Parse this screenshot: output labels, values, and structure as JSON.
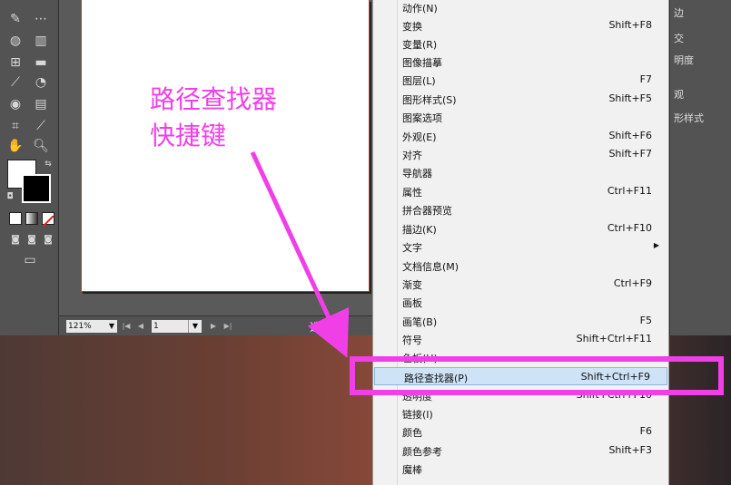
{
  "annotation": {
    "line1": "路径查找器",
    "line2": "快捷键"
  },
  "statusbar": {
    "zoom": "121%",
    "page": "1",
    "status": "选择"
  },
  "right_panel": {
    "items": [
      "边",
      "交",
      "明度",
      "观",
      "形样式"
    ]
  },
  "menu": {
    "items": [
      {
        "label": "动作(N)",
        "shortcut": ""
      },
      {
        "label": "变换",
        "shortcut": "Shift+F8"
      },
      {
        "label": "变量(R)",
        "shortcut": ""
      },
      {
        "label": "图像描摹",
        "shortcut": ""
      },
      {
        "label": "图层(L)",
        "shortcut": "F7"
      },
      {
        "label": "图形样式(S)",
        "shortcut": "Shift+F5"
      },
      {
        "label": "图案选项",
        "shortcut": ""
      },
      {
        "label": "外观(E)",
        "shortcut": "Shift+F6"
      },
      {
        "label": "对齐",
        "shortcut": "Shift+F7"
      },
      {
        "label": "导航器",
        "shortcut": ""
      },
      {
        "label": "属性",
        "shortcut": "Ctrl+F11"
      },
      {
        "label": "拼合器预览",
        "shortcut": ""
      },
      {
        "label": "描边(K)",
        "shortcut": "Ctrl+F10"
      },
      {
        "label": "文字",
        "shortcut": ""
      },
      {
        "label": "文档信息(M)",
        "shortcut": ""
      },
      {
        "label": "渐变",
        "shortcut": "Ctrl+F9"
      },
      {
        "label": "画板",
        "shortcut": ""
      },
      {
        "label": "画笔(B)",
        "shortcut": "F5"
      },
      {
        "label": "符号",
        "shortcut": "Shift+Ctrl+F11"
      },
      {
        "label": "色板(H)",
        "shortcut": ""
      },
      {
        "label": "路径查找器(P)",
        "shortcut": "Shift+Ctrl+F9"
      },
      {
        "label": "透明度",
        "shortcut": "Shift+Ctrl+F10"
      },
      {
        "label": "链接(I)",
        "shortcut": ""
      },
      {
        "label": "颜色",
        "shortcut": "F6"
      },
      {
        "label": "颜色参考",
        "shortcut": "Shift+F3"
      },
      {
        "label": "魔棒",
        "shortcut": ""
      }
    ]
  },
  "colors": {
    "annotation": "#f13fe8",
    "highlight_bg": "#cfe3f6",
    "menu_bg": "#f1f1f1"
  }
}
